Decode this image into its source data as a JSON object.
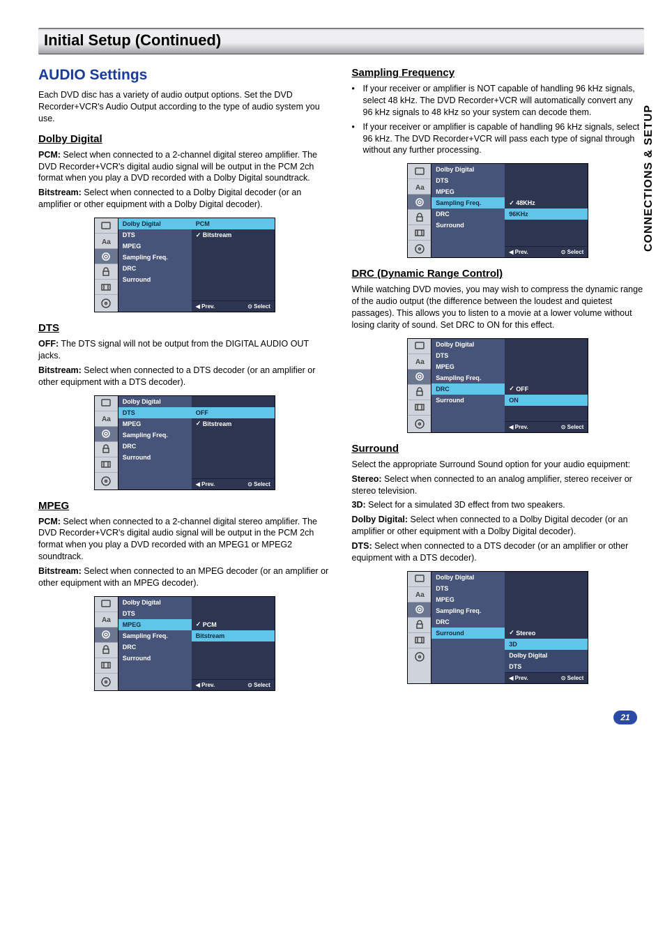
{
  "header": {
    "title": "Initial Setup (Continued)"
  },
  "side_tab": "CONNECTIONS & SETUP",
  "page_number": "21",
  "left": {
    "section_title": "AUDIO Settings",
    "intro": "Each DVD disc has a variety of audio output options. Set the DVD Recorder+VCR's Audio Output according to the type of audio system you use.",
    "dolby": {
      "title": "Dolby Digital",
      "pcm_label": "PCM:",
      "pcm_text": " Select when connected to a 2-channel digital stereo amplifier. The DVD Recorder+VCR's digital audio signal will be output in the PCM 2ch format when you play a DVD recorded with a Dolby Digital soundtrack.",
      "bits_label": "Bitstream:",
      "bits_text": " Select when connected to a Dolby Digital decoder (or an amplifier or other equipment with a Dolby Digital decoder)."
    },
    "dts": {
      "title": "DTS",
      "off_label": "OFF:",
      "off_text": " The DTS signal will not be output from the DIGITAL AUDIO OUT jacks.",
      "bits_label": "Bitstream:",
      "bits_text": " Select when connected to a DTS decoder (or an amplifier or other equipment with a DTS decoder)."
    },
    "mpeg": {
      "title": "MPEG",
      "pcm_label": "PCM:",
      "pcm_text": " Select when connected to a 2-channel digital stereo amplifier. The DVD Recorder+VCR's digital audio signal will be output in the PCM 2ch format when you play a DVD recorded with an MPEG1 or MPEG2 soundtrack.",
      "bits_label": "Bitstream:",
      "bits_text": " Select when connected to an MPEG decoder (or an amplifier or other equipment with an MPEG decoder)."
    }
  },
  "right": {
    "sampling": {
      "title": "Sampling Frequency",
      "bullet1": "If your receiver or amplifier is NOT capable of handling 96 kHz signals, select 48 kHz. The DVD Recorder+VCR will automatically convert any 96 kHz signals to 48 kHz so your system can decode them.",
      "bullet2": "If your receiver or amplifier is capable of handling 96 kHz signals, select 96 kHz. The DVD Recorder+VCR will pass each type of signal through without any further processing."
    },
    "drc": {
      "title": "DRC (Dynamic Range Control)",
      "text": "While watching DVD movies, you may wish to compress the dynamic range of the audio output (the difference between the loudest and quietest passages). This allows you to listen to a movie at a lower volume without losing clarity of sound. Set DRC to ON for this effect."
    },
    "surround": {
      "title": "Surround",
      "intro": "Select the appropriate Surround Sound option for your audio equipment:",
      "stereo_label": "Stereo:",
      "stereo_text": " Select when connected to an analog amplifier, stereo receiver or stereo television.",
      "d3_label": "3D:",
      "d3_text": " Select for a simulated 3D effect from two speakers.",
      "dd_label": "Dolby Digital:",
      "dd_text": " Select when connected to a Dolby Digital decoder (or an amplifier or other equipment with a Dolby Digital decoder).",
      "dts_label": "DTS:",
      "dts_text": " Select when connected to a DTS decoder (or an amplifier or other equipment with a DTS decoder)."
    }
  },
  "osd_labels": {
    "items": [
      "Dolby Digital",
      "DTS",
      "MPEG",
      "Sampling Freq.",
      "DRC",
      "Surround"
    ],
    "footer_prev": "◀ Prev.",
    "footer_select": "⊙ Select",
    "dolby_opts": [
      "PCM",
      "Bitstream"
    ],
    "dts_opts": [
      "OFF",
      "Bitstream"
    ],
    "mpeg_opts": [
      "PCM",
      "Bitstream"
    ],
    "sampling_opts": [
      "48KHz",
      "96KHz"
    ],
    "drc_opts": [
      "OFF",
      "ON"
    ],
    "surround_opts": [
      "Stereo",
      "3D",
      "Dolby Digital",
      "DTS"
    ]
  }
}
